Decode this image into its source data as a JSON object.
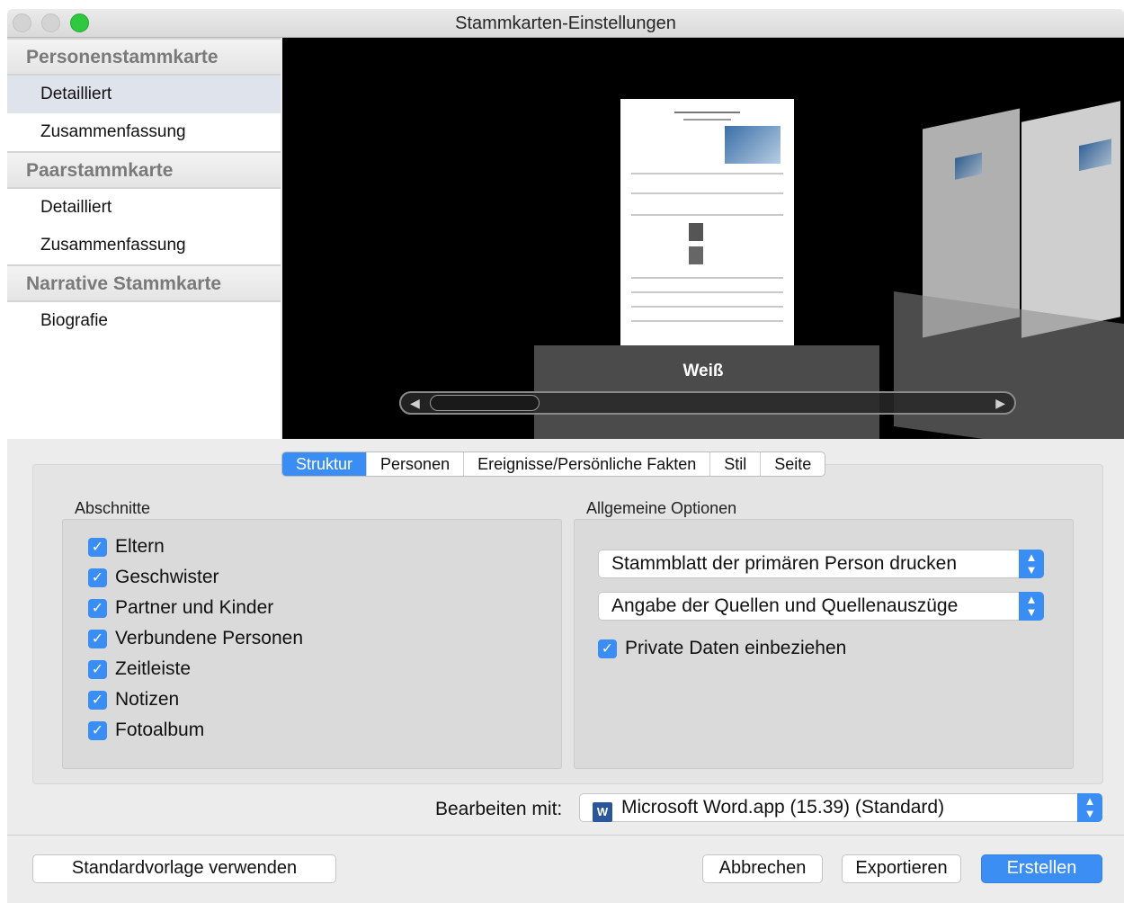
{
  "window": {
    "title": "Stammkarten-Einstellungen"
  },
  "sidebar": {
    "groups": [
      {
        "title": "Personenstammkarte",
        "items": [
          "Detailliert",
          "Zusammenfassung"
        ]
      },
      {
        "title": "Paarstammkarte",
        "items": [
          "Detailliert",
          "Zusammenfassung"
        ]
      },
      {
        "title": "Narrative Stammkarte",
        "items": [
          "Biografie"
        ]
      }
    ],
    "selected": "Personenstammkarte / Detailliert"
  },
  "preview": {
    "label": "Weiß"
  },
  "tabs": [
    "Struktur",
    "Personen",
    "Ereignisse/Persönliche Fakten",
    "Stil",
    "Seite"
  ],
  "active_tab": "Struktur",
  "sections": {
    "title": "Abschnitte",
    "items": [
      {
        "label": "Eltern",
        "checked": true
      },
      {
        "label": "Geschwister",
        "checked": true
      },
      {
        "label": "Partner und Kinder",
        "checked": true
      },
      {
        "label": "Verbundene Personen",
        "checked": true
      },
      {
        "label": "Zeitleiste",
        "checked": true
      },
      {
        "label": "Notizen",
        "checked": true
      },
      {
        "label": "Fotoalbum",
        "checked": true
      }
    ]
  },
  "general_options": {
    "title": "Allgemeine Optionen",
    "popup1": "Stammblatt der primären Person drucken",
    "popup2": "Angabe der Quellen und Quellenauszüge",
    "private_data": {
      "label": "Private Daten einbeziehen",
      "checked": true
    }
  },
  "edit_with": {
    "label": "Bearbeiten mit:",
    "value": "Microsoft Word.app (15.39) (Standard)",
    "icon": "word-icon"
  },
  "buttons": {
    "default_template": "Standardvorlage verwenden",
    "cancel": "Abbrechen",
    "export": "Exportieren",
    "create": "Erstellen"
  },
  "colors": {
    "accent": "#3a8df2",
    "preview_bg": "#000000",
    "window_bg": "#ececec"
  }
}
